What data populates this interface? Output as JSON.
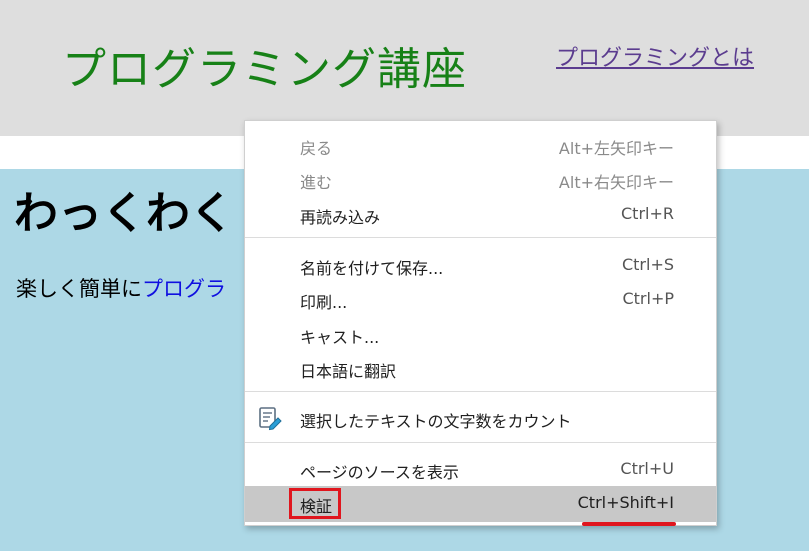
{
  "header": {
    "title": "プログラミング講座",
    "nav_link": "プログラミングとは"
  },
  "main": {
    "heading": "わっくわく",
    "intro_text": "楽しく簡単に",
    "intro_link": "プログラ"
  },
  "context_menu": {
    "items": [
      {
        "label": "戻る",
        "shortcut": "Alt+左矢印キー",
        "disabled": true
      },
      {
        "label": "進む",
        "shortcut": "Alt+右矢印キー",
        "disabled": true
      },
      {
        "label": "再読み込み",
        "shortcut": "Ctrl+R"
      },
      {
        "label": "名前を付けて保存...",
        "shortcut": "Ctrl+S"
      },
      {
        "label": "印刷...",
        "shortcut": "Ctrl+P"
      },
      {
        "label": "キャスト..."
      },
      {
        "label": "日本語に翻訳"
      },
      {
        "label": "選択したテキストの文字数をカウント",
        "icon": "edit-document-icon"
      },
      {
        "label": "ページのソースを表示",
        "shortcut": "Ctrl+U"
      },
      {
        "label": "検証",
        "shortcut": "Ctrl+Shift+I",
        "highlighted": true
      }
    ]
  },
  "annotation_color": "#e0161e"
}
